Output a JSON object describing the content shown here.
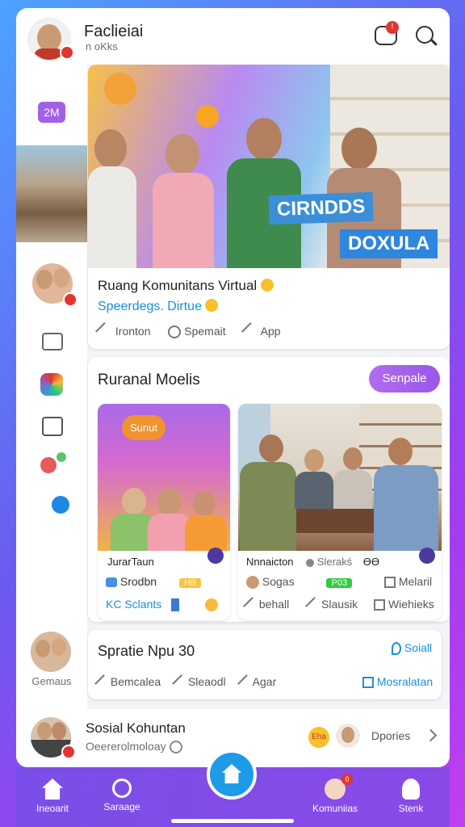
{
  "header": {
    "title": "Faclieiai",
    "subtitle": "n oKks",
    "notif_badge": "!"
  },
  "sidebar": {
    "badge": "2M",
    "avatar_label": "Gemaus"
  },
  "hero": {
    "banner_top": "CIRNDDS",
    "banner_bottom": "DOXULA",
    "title": "Ruang Komunitans Virtual",
    "subtitle": "Speerdegs. Dirtue",
    "actions": [
      "Ironton",
      "Spemait",
      "App"
    ]
  },
  "section": {
    "title": "Ruranal Moelis",
    "button": "Senpale",
    "bubble": "Sunut",
    "cards": [
      {
        "title": "JurarTaun",
        "row1_left": "Srodbn",
        "row1_right": "Hili",
        "row2_left": "KC Sclants"
      },
      {
        "title": "Nnnaicton",
        "title_extra": "Slerakś",
        "title_tail": "ƟƟ",
        "row1_left": "Sogas",
        "row1_mid": "P03",
        "row1_right": "Melaril",
        "row2_left": "behall",
        "row2_mid": "Slausik",
        "row2_right": "Wiehieks"
      }
    ]
  },
  "post": {
    "title": "Spratie Npu 30",
    "tag": "Soiall",
    "actions": [
      "Bemcalea",
      "Sleaodl",
      "Agar"
    ],
    "link": "Mosralatan"
  },
  "footer_row": {
    "title": "Sosial Kohuntan",
    "subtitle": "Oeererolmoloay",
    "pill": "Eha",
    "link": "Dpories"
  },
  "bottom_nav": [
    {
      "label": "Ineoarit"
    },
    {
      "label": "Saraage"
    },
    {
      "label": ""
    },
    {
      "label": "Komuniias",
      "badge": "0"
    },
    {
      "label": "Stenk"
    }
  ],
  "colors": {
    "accent": "#8a4ae8",
    "link": "#1a8fd8",
    "danger": "#e3342f",
    "center_button": "#1e9be8"
  }
}
